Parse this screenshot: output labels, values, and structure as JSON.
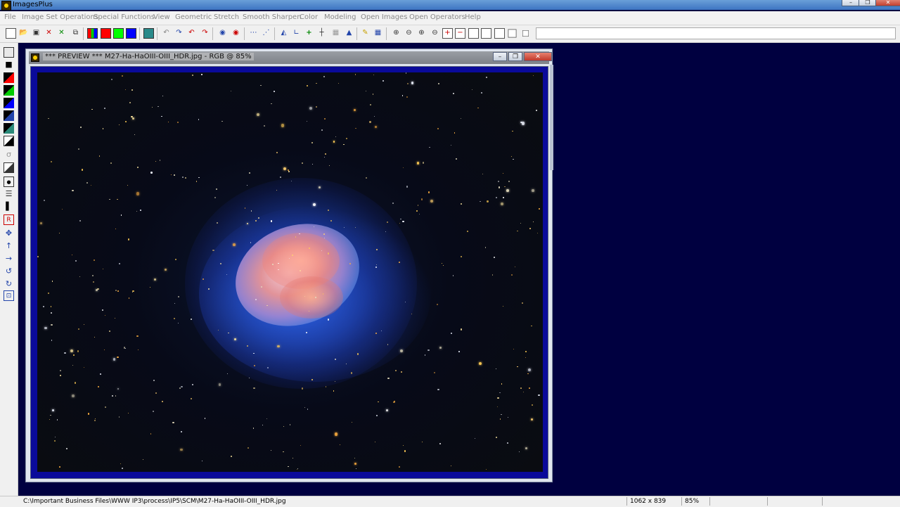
{
  "app": {
    "title": "ImagesPlus"
  },
  "window_buttons": [
    "–",
    "❐",
    "✕"
  ],
  "menu": [
    "File",
    "Image Set Operations",
    "Special Functions",
    "View",
    "Geometric",
    "Stretch",
    "Smooth Sharpen",
    "Color",
    "Modeling",
    "Open Images",
    "Open Operators",
    "Help"
  ],
  "child_window": {
    "title": "*** PREVIEW *** M27-Ha-HaOIII-OIII_HDR.jpg - RGB @ 85%",
    "buttons": [
      "–",
      "❐",
      "✕"
    ]
  },
  "statusbar": {
    "path": "C:\\Important Business Files\\WWW IP3\\process\\IP5\\SCM\\M27-Ha-HaOIII-OIII_HDR.jpg",
    "dimensions": "1062 x 839",
    "zoom": "85%"
  },
  "colors": {
    "workspace": "#000040",
    "image_frame": "#0a0a9a",
    "toolbar_red": "#ff0000",
    "toolbar_green": "#00ff00",
    "toolbar_blue": "#0000ff"
  }
}
